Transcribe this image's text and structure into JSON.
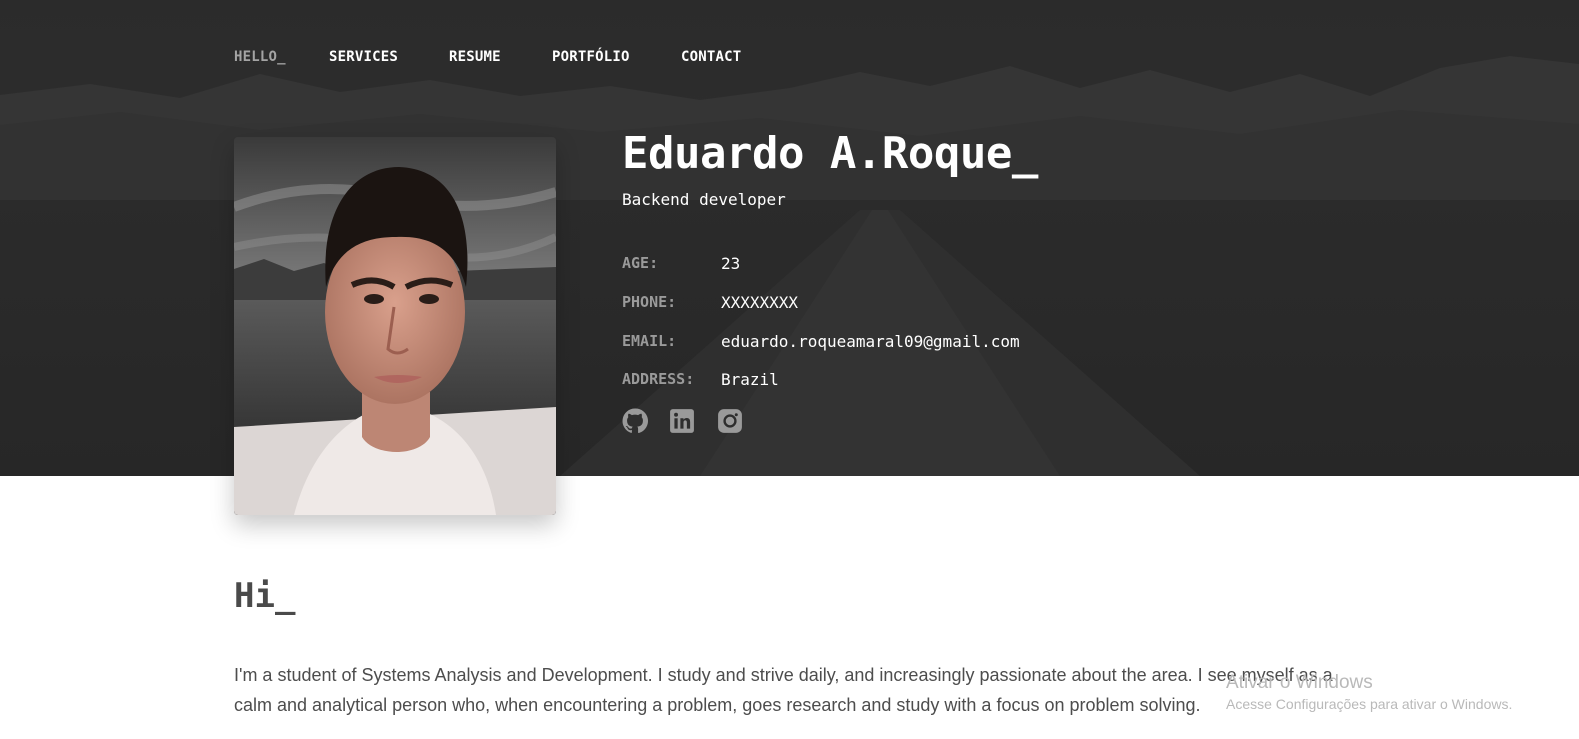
{
  "nav": {
    "items": [
      {
        "label": "HELLO_",
        "active": true
      },
      {
        "label": "SERVICES",
        "active": false
      },
      {
        "label": "RESUME",
        "active": false
      },
      {
        "label": "PORTFÓLIO",
        "active": false
      },
      {
        "label": "CONTACT",
        "active": false
      }
    ]
  },
  "profile": {
    "name": "Eduardo A.Roque_",
    "role": "Backend developer",
    "info": [
      {
        "label": "AGE:",
        "value": "23"
      },
      {
        "label": "PHONE:",
        "value": "XXXXXXXX"
      },
      {
        "label": "EMAIL:",
        "value": "eduardo.roqueamaral09@gmail.com"
      },
      {
        "label": "ADDRESS:",
        "value": "Brazil"
      }
    ],
    "social_icons": [
      "github-icon",
      "linkedin-icon",
      "instagram-icon"
    ]
  },
  "about": {
    "title": "Hi_",
    "text": "I'm a student of Systems Analysis and Development. I study and strive daily, and increasingly passionate about the area. I see myself as a calm and analytical person who, when encountering a problem, goes research and study with a focus on problem solving."
  },
  "os_watermark": {
    "title": "Ativar o Windows",
    "subtitle": "Acesse Configurações para ativar o Windows."
  },
  "colors": {
    "hero_bg": "#2b2b2b",
    "nav_active": "#a4a4a4",
    "label_gray": "#9a9a9a",
    "body_text": "#4d4d4d",
    "heading_text": "#4a4a4a"
  }
}
